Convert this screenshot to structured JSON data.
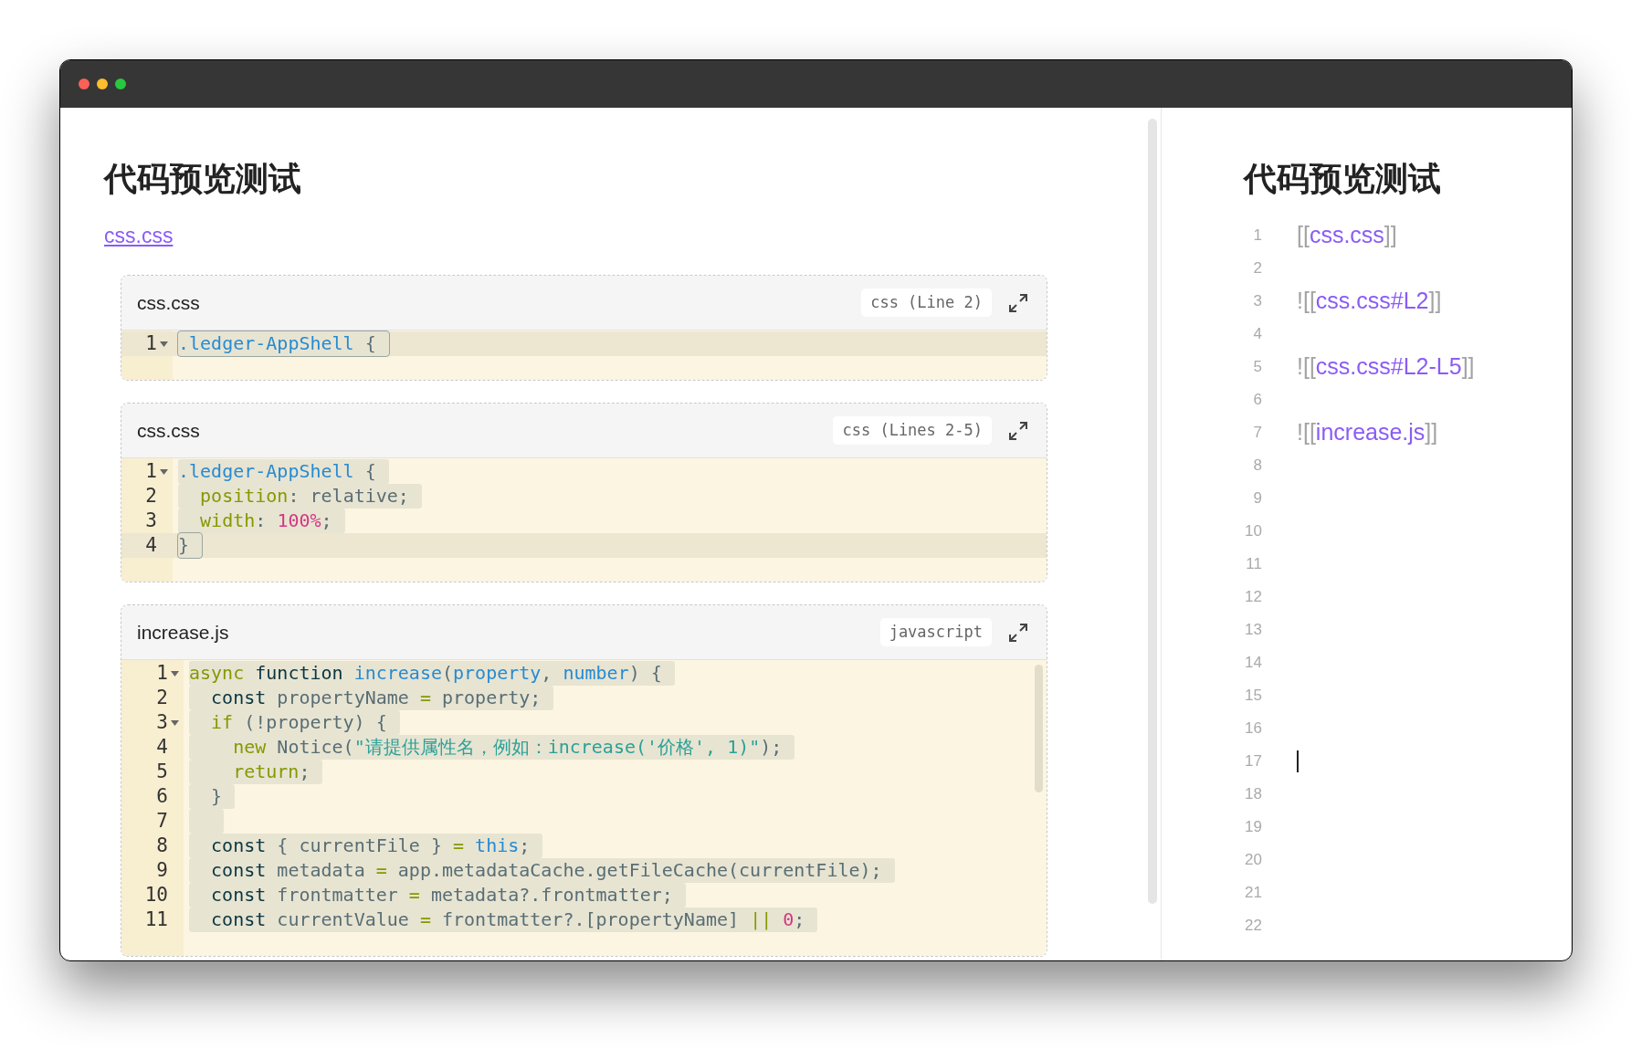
{
  "preview": {
    "title": "代码预览测试",
    "link": "css.css",
    "blocks": [
      {
        "filename": "css.css",
        "badge": "css (Line 2)",
        "lines": [
          {
            "number": "1",
            "fold": true,
            "active": true,
            "tokens": [
              {
                "kind": "name",
                "text": ".ledger-AppShell"
              },
              {
                "kind": "text",
                "text": " {"
              }
            ]
          }
        ]
      },
      {
        "filename": "css.css",
        "badge": "css (Lines 2-5)",
        "lines": [
          {
            "number": "1",
            "fold": true,
            "active": false,
            "tokens": [
              {
                "kind": "name",
                "text": ".ledger-AppShell"
              },
              {
                "kind": "text",
                "text": " {"
              }
            ]
          },
          {
            "number": "2",
            "fold": false,
            "active": false,
            "tokens": [
              {
                "kind": "keyword",
                "text": "  position"
              },
              {
                "kind": "text",
                "text": ": relative;"
              }
            ]
          },
          {
            "number": "3",
            "fold": false,
            "active": false,
            "tokens": [
              {
                "kind": "keyword",
                "text": "  width"
              },
              {
                "kind": "text",
                "text": ": "
              },
              {
                "kind": "number",
                "text": "100%"
              },
              {
                "kind": "text",
                "text": ";"
              }
            ]
          },
          {
            "number": "4",
            "fold": false,
            "active": true,
            "tokens": [
              {
                "kind": "text",
                "text": "}"
              }
            ]
          }
        ]
      },
      {
        "filename": "increase.js",
        "badge": "javascript",
        "lines": [
          {
            "number": "1",
            "fold": true,
            "active": false,
            "tokens": [
              {
                "kind": "keyword",
                "text": "async"
              },
              {
                "kind": "storage",
                "text": " function"
              },
              {
                "kind": "name",
                "text": " increase"
              },
              {
                "kind": "text",
                "text": "("
              },
              {
                "kind": "name",
                "text": "property"
              },
              {
                "kind": "text",
                "text": ", "
              },
              {
                "kind": "name",
                "text": "number"
              },
              {
                "kind": "text",
                "text": ") {"
              }
            ]
          },
          {
            "number": "2",
            "fold": false,
            "active": false,
            "tokens": [
              {
                "kind": "storage",
                "text": "  const"
              },
              {
                "kind": "text",
                "text": " propertyName "
              },
              {
                "kind": "keyword",
                "text": "="
              },
              {
                "kind": "text",
                "text": " property;"
              }
            ]
          },
          {
            "number": "3",
            "fold": true,
            "active": false,
            "tokens": [
              {
                "kind": "keyword",
                "text": "  if"
              },
              {
                "kind": "text",
                "text": " (!property) {"
              }
            ]
          },
          {
            "number": "4",
            "fold": false,
            "active": false,
            "tokens": [
              {
                "kind": "keyword",
                "text": "    new"
              },
              {
                "kind": "text",
                "text": " Notice("
              },
              {
                "kind": "string",
                "text": "\"请提供属性名，例如：increase('价格', 1)\""
              },
              {
                "kind": "text",
                "text": ");"
              }
            ]
          },
          {
            "number": "5",
            "fold": false,
            "active": false,
            "tokens": [
              {
                "kind": "keyword",
                "text": "    return"
              },
              {
                "kind": "text",
                "text": ";"
              }
            ]
          },
          {
            "number": "6",
            "fold": false,
            "active": false,
            "tokens": [
              {
                "kind": "text",
                "text": "  }"
              }
            ]
          },
          {
            "number": "7",
            "fold": false,
            "active": false
          },
          {
            "number": "8",
            "fold": false,
            "active": false,
            "tokens": [
              {
                "kind": "storage",
                "text": "  const"
              },
              {
                "kind": "text",
                "text": " { currentFile } "
              },
              {
                "kind": "keyword",
                "text": "="
              },
              {
                "kind": "name",
                "text": " this"
              },
              {
                "kind": "text",
                "text": ";"
              }
            ]
          },
          {
            "number": "9",
            "fold": false,
            "active": false,
            "tokens": [
              {
                "kind": "storage",
                "text": "  const"
              },
              {
                "kind": "text",
                "text": " metadata "
              },
              {
                "kind": "keyword",
                "text": "="
              },
              {
                "kind": "text",
                "text": " app.metadataCache.getFileCache(currentFile);"
              }
            ]
          },
          {
            "number": "10",
            "fold": false,
            "active": false,
            "tokens": [
              {
                "kind": "storage",
                "text": "  const"
              },
              {
                "kind": "text",
                "text": " frontmatter "
              },
              {
                "kind": "keyword",
                "text": "="
              },
              {
                "kind": "text",
                "text": " metadata?.frontmatter;"
              }
            ]
          },
          {
            "number": "11",
            "fold": false,
            "active": false,
            "tokens": [
              {
                "kind": "storage",
                "text": "  const"
              },
              {
                "kind": "text",
                "text": " currentValue "
              },
              {
                "kind": "keyword",
                "text": "="
              },
              {
                "kind": "text",
                "text": " frontmatter?.[propertyName] "
              },
              {
                "kind": "keyword",
                "text": "||"
              },
              {
                "kind": "number",
                "text": " 0"
              },
              {
                "kind": "text",
                "text": ";"
              }
            ]
          }
        ]
      }
    ]
  },
  "source": {
    "title": "代码预览测试",
    "lines": [
      {
        "number": "1",
        "cursor": false,
        "parts": [
          {
            "kind": "bracket",
            "text": "[["
          },
          {
            "kind": "link",
            "text": "css.css"
          },
          {
            "kind": "bracket",
            "text": "]]"
          }
        ]
      },
      {
        "number": "2",
        "cursor": false
      },
      {
        "number": "3",
        "cursor": false,
        "parts": [
          {
            "kind": "bracket",
            "text": "![["
          },
          {
            "kind": "link",
            "text": "css.css#L2"
          },
          {
            "kind": "bracket",
            "text": "]]"
          }
        ]
      },
      {
        "number": "4",
        "cursor": false
      },
      {
        "number": "5",
        "cursor": false,
        "parts": [
          {
            "kind": "bracket",
            "text": "![["
          },
          {
            "kind": "link",
            "text": "css.css#L2-L5"
          },
          {
            "kind": "bracket",
            "text": "]]"
          }
        ]
      },
      {
        "number": "6",
        "cursor": false
      },
      {
        "number": "7",
        "cursor": false,
        "parts": [
          {
            "kind": "bracket",
            "text": "![["
          },
          {
            "kind": "link",
            "text": "increase.js"
          },
          {
            "kind": "bracket",
            "text": "]]"
          }
        ]
      },
      {
        "number": "8",
        "cursor": false
      },
      {
        "number": "9",
        "cursor": false
      },
      {
        "number": "10",
        "cursor": false
      },
      {
        "number": "11",
        "cursor": false
      },
      {
        "number": "12",
        "cursor": false
      },
      {
        "number": "13",
        "cursor": false
      },
      {
        "number": "14",
        "cursor": false
      },
      {
        "number": "15",
        "cursor": false
      },
      {
        "number": "16",
        "cursor": false
      },
      {
        "number": "17",
        "cursor": true
      },
      {
        "number": "18",
        "cursor": false
      },
      {
        "number": "19",
        "cursor": false
      },
      {
        "number": "20",
        "cursor": false
      },
      {
        "number": "21",
        "cursor": false
      },
      {
        "number": "22",
        "cursor": false
      }
    ]
  }
}
